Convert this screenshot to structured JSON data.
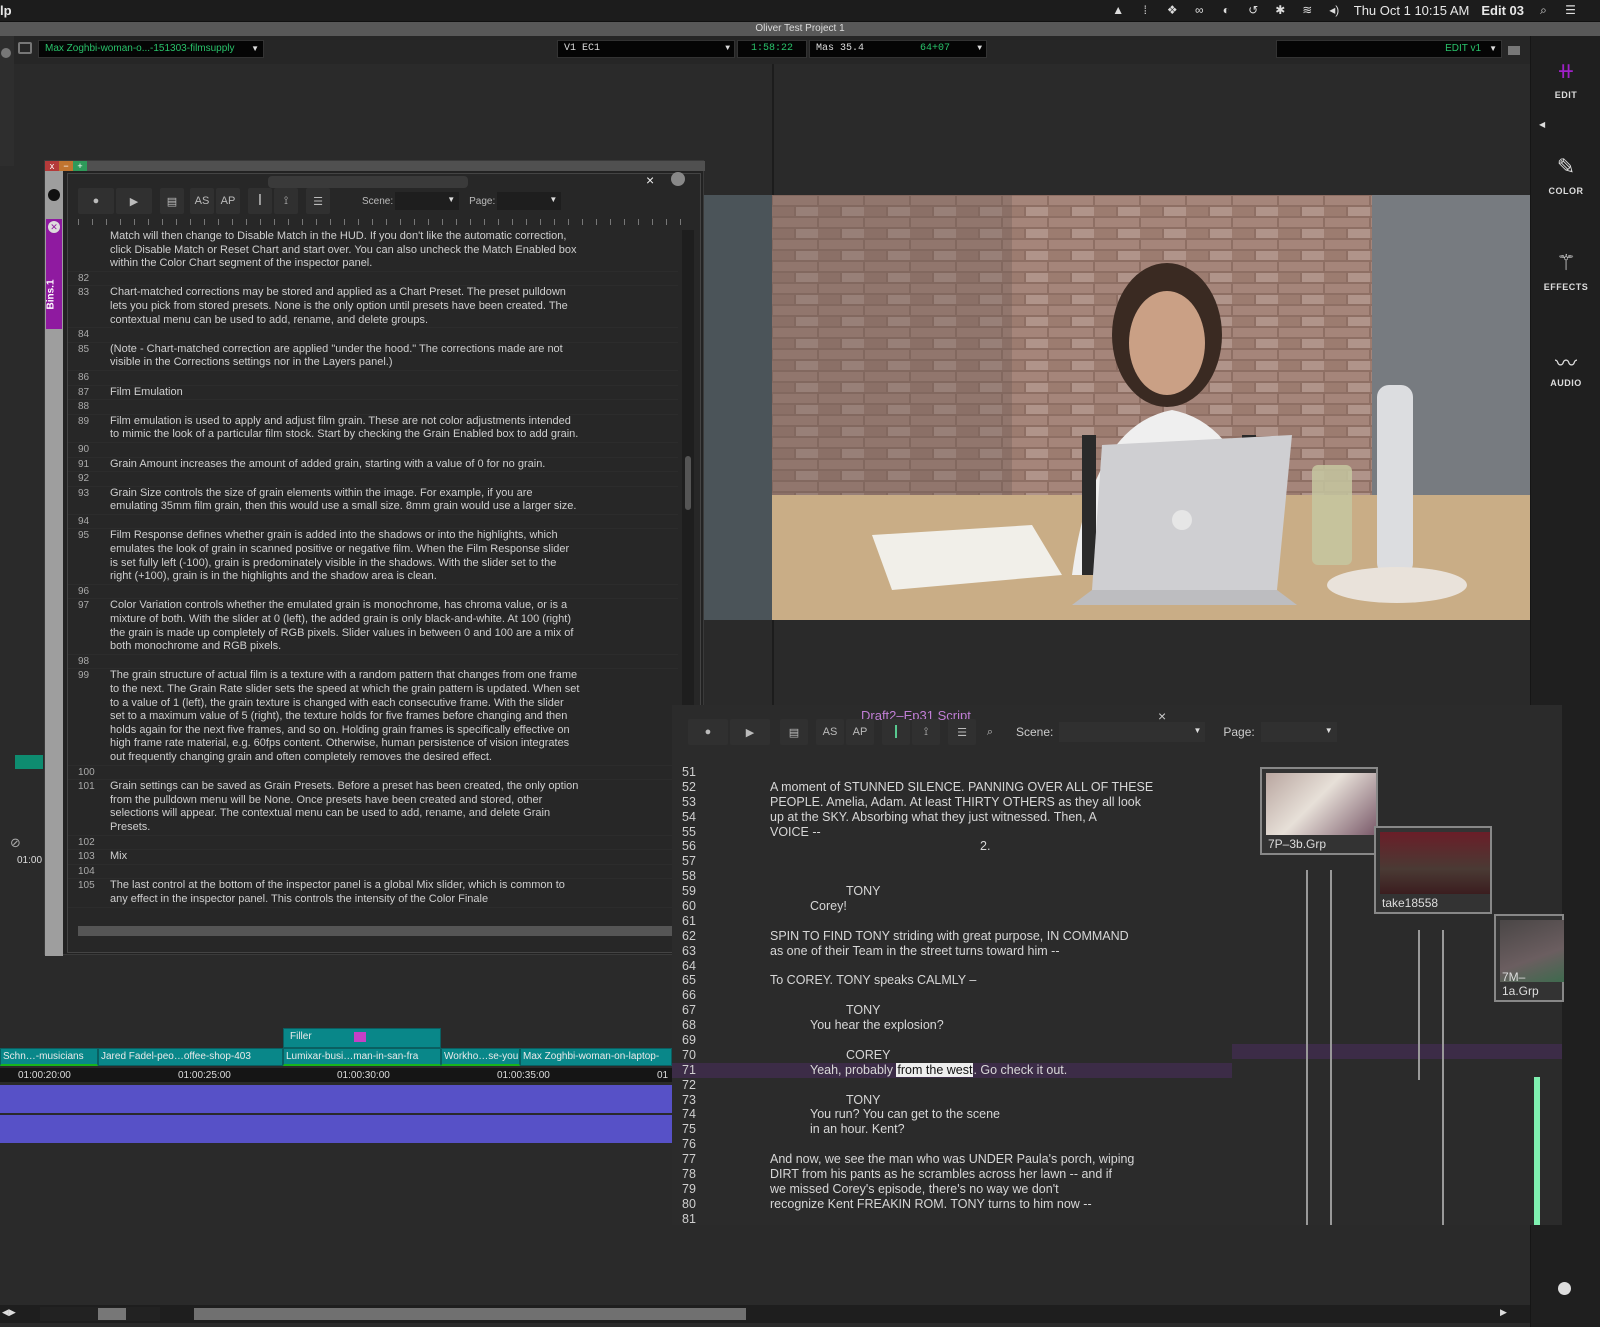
{
  "menubar": {
    "app_menu_fragment": "lp",
    "clock": "Thu Oct 1  10:15 AM",
    "user": "Edit 03",
    "icons": [
      "nord-icon",
      "sliders-icon",
      "dropbox-icon",
      "creative-cloud-icon",
      "sync-icon",
      "time-machine-icon",
      "bluetooth-icon",
      "wifi-icon",
      "volume-icon",
      "search-icon",
      "list-icon"
    ]
  },
  "project": {
    "title": "Oliver Test Project 1"
  },
  "toolbar": {
    "clip_name": "Max Zoghbi-woman-o...-151303-filmsupply",
    "track": "V1  EC1",
    "timecode": "1:58:22",
    "mas": "Mas 35.4",
    "mas_value": "64+07",
    "sequence": "EDIT v1"
  },
  "right_sidebar": {
    "items": [
      {
        "label": "EDIT",
        "icon": "edit-icon",
        "active": true
      },
      {
        "label": "COLOR",
        "icon": "eyedropper-icon"
      },
      {
        "label": "EFFECTS",
        "icon": "magic-wand-icon"
      },
      {
        "label": "AUDIO",
        "icon": "waveform-icon"
      }
    ]
  },
  "doc_window": {
    "bins_tab": "Bins.1",
    "scene_label": "Scene:",
    "page_label": "Page:",
    "buttons": {
      "as": "AS",
      "ap": "AP"
    },
    "lines": [
      {
        "n": "",
        "t": "Match will then change to Disable Match in the HUD. If you don't like the automatic correction, click Disable Match or Reset Chart and start over. You can also uncheck the Match Enabled box within the Color Chart segment of the inspector panel."
      },
      {
        "n": "82",
        "t": ""
      },
      {
        "n": "83",
        "t": "Chart-matched corrections may be stored and applied as a Chart Preset. The preset pulldown lets you pick from stored presets. None is the only option until presets have been created. The contextual menu can be used to add, rename, and delete groups."
      },
      {
        "n": "84",
        "t": ""
      },
      {
        "n": "85",
        "t": "(Note - Chart-matched correction are applied \"under the hood.\" The corrections made are not visible in the Corrections settings nor in the Layers panel.)"
      },
      {
        "n": "86",
        "t": ""
      },
      {
        "n": "87",
        "t": "Film Emulation"
      },
      {
        "n": "88",
        "t": ""
      },
      {
        "n": "89",
        "t": "Film emulation is used to apply and adjust film grain. These are not color adjustments intended to mimic the look of a particular film stock. Start by checking the Grain Enabled box to add grain."
      },
      {
        "n": "90",
        "t": ""
      },
      {
        "n": "91",
        "t": "Grain Amount increases the amount of added grain, starting with a value of 0 for no grain."
      },
      {
        "n": "92",
        "t": ""
      },
      {
        "n": "93",
        "t": "Grain Size controls the size of grain elements within the image. For example, if you are emulating 35mm film grain, then this would use a small size. 8mm grain would use a larger size."
      },
      {
        "n": "94",
        "t": ""
      },
      {
        "n": "95",
        "t": "Film Response defines whether grain is added into the shadows or into the highlights, which emulates the look of grain in scanned positive or negative film. When the Film Response slider is set fully left (-100), grain is predominately visible in the shadows. With the slider set to the right (+100), grain is in the highlights and the shadow area is clean."
      },
      {
        "n": "96",
        "t": ""
      },
      {
        "n": "97",
        "t": "Color Variation controls whether the emulated grain is monochrome, has chroma value, or is a mixture of both. With the slider at 0 (left), the added grain is only black-and-white. At 100 (right) the grain is made up completely of RGB pixels. Slider values in between 0 and 100 are a mix of both monochrome and RGB pixels."
      },
      {
        "n": "98",
        "t": ""
      },
      {
        "n": "99",
        "t": "The grain structure of actual film is a texture with a random pattern that changes from one frame to the next. The Grain Rate slider sets the speed at which the grain pattern is updated. When set to a value of 1 (left), the grain texture is changed with each consecutive frame. With the slider set to a maximum value of 5 (right), the texture holds for five frames before changing and then holds again for the next five frames, and so on. Holding grain frames is specifically effective on high frame rate material, e.g. 60fps content. Otherwise, human persistence of vision integrates out frequently changing grain and often completely removes the desired effect."
      },
      {
        "n": "100",
        "t": ""
      },
      {
        "n": "101",
        "t": "Grain settings can be saved as Grain Presets. Before a preset has been created, the only option from the pulldown menu will be None. Once presets have been created and stored, other selections will appear. The contextual menu can be used to add, rename, and delete Grain Presets."
      },
      {
        "n": "102",
        "t": ""
      },
      {
        "n": "103",
        "t": "Mix"
      },
      {
        "n": "104",
        "t": ""
      },
      {
        "n": "105",
        "t": "The last control at the bottom of the inspector panel is a global Mix slider, which is common to any effect in the inspector panel. This controls the intensity of the Color Finale"
      }
    ]
  },
  "timeline": {
    "filler_label": "Filler",
    "clips": [
      {
        "label": "Schn…-musicians"
      },
      {
        "label": "Jared Fadel-peo…offee-shop-403"
      },
      {
        "label": "Lumixar-busi…man-in-san-fra"
      },
      {
        "label": "Workho…se-you"
      },
      {
        "label": "Max Zoghbi-woman-on-laptop-"
      }
    ],
    "timecodes": [
      "01:00:20:00",
      "01:00:25:00",
      "01:00:30:00",
      "01:00:35:00",
      "01"
    ],
    "side_timecode": "01:00"
  },
  "script_window": {
    "title": "Draft2–Ep31 Script",
    "scene_label": "Scene:",
    "page_label": "Page:",
    "buttons": {
      "as": "AS",
      "ap": "AP"
    },
    "lines": [
      {
        "n": "51",
        "t": "",
        "indent": 0
      },
      {
        "n": "52",
        "t": "A moment of STUNNED SILENCE. PANNING OVER ALL OF THESE",
        "indent": 0
      },
      {
        "n": "53",
        "t": "PEOPLE. Amelia, Adam. At least THIRTY OTHERS as they all look",
        "indent": 0
      },
      {
        "n": "54",
        "t": "up at the SKY. Absorbing what they just witnessed. Then, A",
        "indent": 0
      },
      {
        "n": "55",
        "t": "VOICE --",
        "indent": 0
      },
      {
        "n": "56",
        "t": "2.",
        "indent": 3
      },
      {
        "n": "57",
        "t": "",
        "indent": 0
      },
      {
        "n": "58",
        "t": "",
        "indent": 0
      },
      {
        "n": "59",
        "t": "TONY",
        "indent": 2
      },
      {
        "n": "60",
        "t": "Corey!",
        "indent": 1
      },
      {
        "n": "61",
        "t": "",
        "indent": 0
      },
      {
        "n": "62",
        "t": "SPIN TO FIND TONY striding with great purpose, IN COMMAND",
        "indent": 0
      },
      {
        "n": "63",
        "t": "as one of their Team in the street turns toward him --",
        "indent": 0
      },
      {
        "n": "64",
        "t": "",
        "indent": 0
      },
      {
        "n": "65",
        "t": "To COREY. TONY speaks CALMLY –",
        "indent": 0
      },
      {
        "n": "66",
        "t": "",
        "indent": 0
      },
      {
        "n": "67",
        "t": "TONY",
        "indent": 2
      },
      {
        "n": "68",
        "t": "You hear the explosion?",
        "indent": 1
      },
      {
        "n": "69",
        "t": "",
        "indent": 0
      },
      {
        "n": "70",
        "t": "COREY",
        "indent": 2
      },
      {
        "n": "71",
        "t": "Yeah, probably ",
        "sel": "from the west",
        "after": ". Go check it out.",
        "indent": 1,
        "highlight": true
      },
      {
        "n": "72",
        "t": "",
        "indent": 0
      },
      {
        "n": "73",
        "t": "TONY",
        "indent": 2
      },
      {
        "n": "74",
        "t": "You run? You can get to the scene",
        "indent": 1
      },
      {
        "n": "75",
        "t": "in an hour. Kent?",
        "indent": 1
      },
      {
        "n": "76",
        "t": "",
        "indent": 0
      },
      {
        "n": "77",
        "t": "And now, we see the man who was UNDER Paula's porch, wiping",
        "indent": 0
      },
      {
        "n": "78",
        "t": "DIRT from his pants as he scrambles across her lawn -- and if",
        "indent": 0
      },
      {
        "n": "79",
        "t": "we missed Corey's episode, there's no way we don't",
        "indent": 0
      },
      {
        "n": "80",
        "t": "recognize Kent FREAKIN ROM. TONY turns to him now --",
        "indent": 0
      },
      {
        "n": "81",
        "t": "",
        "indent": 0
      }
    ],
    "takes": [
      {
        "label": "7P–3b.Grp"
      },
      {
        "label": "take18558"
      },
      {
        "label": "7M–1a.Grp"
      }
    ]
  },
  "colors": {
    "accent_purple": "#a020c8",
    "timecode_green": "#29c26a",
    "clip_teal": "#098789",
    "audio_track": "#5751c7",
    "highlight_row": "#3c2c47",
    "take_bar_green": "#7ff0b0"
  }
}
